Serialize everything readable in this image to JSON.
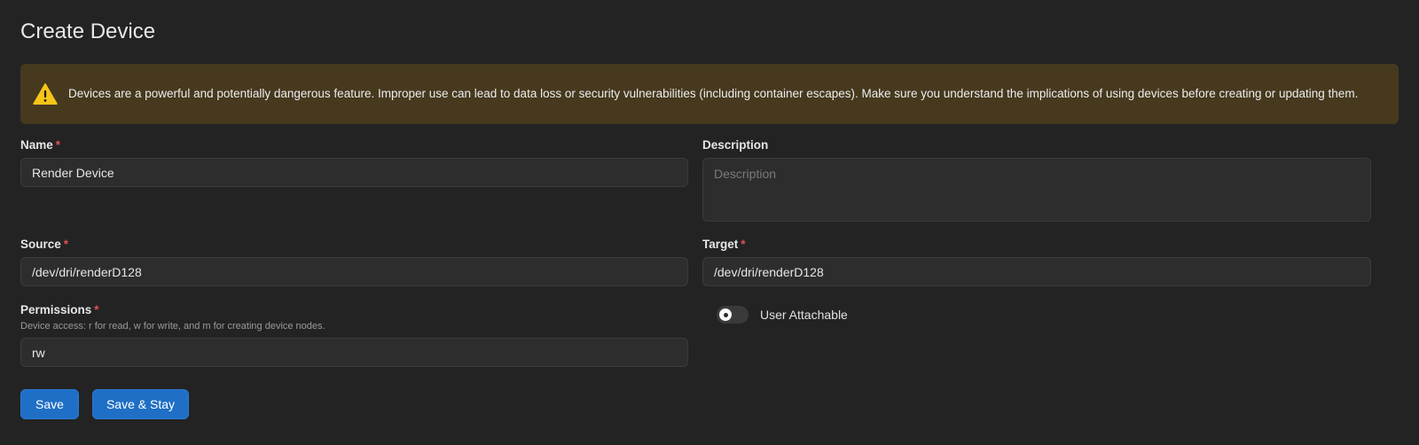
{
  "page": {
    "title": "Create Device"
  },
  "alert": {
    "icon": "warning-icon",
    "color": "#46391e",
    "text": "Devices are a powerful and potentially dangerous feature. Improper use can lead to data loss or security vulnerabilities (including container escapes). Make sure you understand the implications of using devices before creating or updating them."
  },
  "form": {
    "name": {
      "label": "Name",
      "required_mark": "*",
      "value": "Render Device"
    },
    "description": {
      "label": "Description",
      "placeholder": "Description",
      "value": ""
    },
    "source": {
      "label": "Source",
      "required_mark": "*",
      "value": "/dev/dri/renderD128"
    },
    "target": {
      "label": "Target",
      "required_mark": "*",
      "value": "/dev/dri/renderD128"
    },
    "permissions": {
      "label": "Permissions",
      "required_mark": "*",
      "hint": "Device access: r for read, w for write, and m for creating device nodes.",
      "value": "rw"
    },
    "user_attachable": {
      "label": "User Attachable",
      "enabled": false
    }
  },
  "actions": {
    "save_label": "Save",
    "save_stay_label": "Save & Stay",
    "accent_color": "#1f6fc6"
  }
}
